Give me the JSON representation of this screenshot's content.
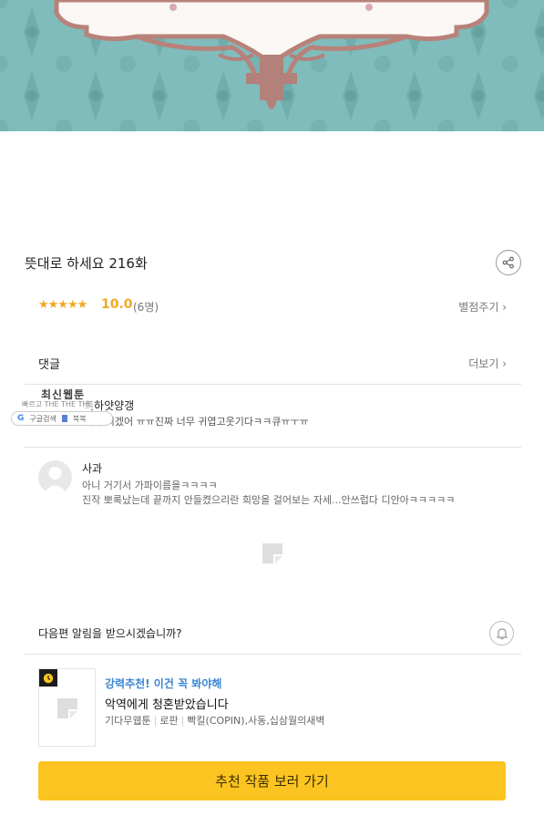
{
  "episode": {
    "title": "뜻대로 하세요 216화"
  },
  "rating": {
    "stars": "★★★★★",
    "score": "10.0",
    "voters": "(6명)",
    "rate_link": "별점주기 ›"
  },
  "comments": {
    "label": "댓글",
    "more_link": "더보기 ›",
    "items": [
      {
        "author": "최하얏양갱",
        "text": "어이 치겠어 ㅠㅠ진짜 너무 귀엽고웃기다ㅋㅋ큐ㅠㅜㅠ"
      },
      {
        "author": "사과",
        "text_line1": "아니 거기서 가파이름을ㅋㅋㅋㅋ",
        "text_line2": "진작 뽀록났는데 끝까지 안들켰으리란 희망을 걸어보는 자세...안쓰럽다 디안아ㅋㅋㅋㅋㅋ"
      }
    ]
  },
  "overlay": {
    "title": "최신웹툰",
    "subtitle": "빠르고 THE THE THE",
    "google_label": "구글검색",
    "bookmark_label": "북북"
  },
  "notify": {
    "text": "다음편 알림을 받으시겠습니까?"
  },
  "recommend": {
    "tag": "강력추천! 이건 꼭 봐야해",
    "title": "악역에게 청혼받았습니다",
    "meta": [
      "기다무웹툰",
      "로판",
      "빡킬(COPIN),사동,십삼월의새벽"
    ],
    "cta_label": "추천 작품 보러 가기"
  },
  "colors": {
    "accent_yellow": "#fcc421",
    "star": "#f1a825",
    "link_blue": "#3a86d4",
    "banner_teal": "#7fbcbb"
  },
  "icons": {
    "share": "share-icon",
    "bell": "bell-icon",
    "clock": "clock-icon"
  }
}
